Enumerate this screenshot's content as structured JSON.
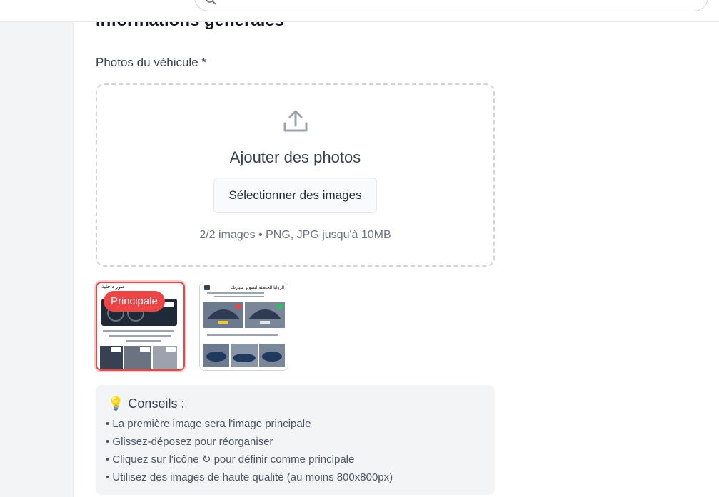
{
  "header": {
    "search_placeholder": ""
  },
  "form": {
    "section_title": "Informations générales",
    "photos_label": "Photos du véhicule *"
  },
  "dropzone": {
    "icon": "upload-icon",
    "title": "Ajouter des photos",
    "button_label": "Sélectionner des images",
    "hint": "2/2 images • PNG, JPG jusqu'à 10MB"
  },
  "thumbnails": [
    {
      "badge": "Principale",
      "is_main": true,
      "header_text": "صور داخلية"
    },
    {
      "badge": "",
      "is_main": false,
      "header_text": "الزوايا الخاطئة لتصوير سيارتك"
    }
  ],
  "tips": {
    "icon": "lightbulb-icon",
    "title": "Conseils :",
    "items": [
      "• La première image sera l'image principale",
      "• Glissez-déposez pour réorganiser",
      "• Cliquez sur l'icône ↻ pour définir comme principale",
      "• Utilisez des images de haute qualité (au moins 800x800px)"
    ]
  },
  "colors": {
    "accent_red": "#ef4444",
    "muted_text": "#6b7280",
    "border": "#d1d5db"
  }
}
